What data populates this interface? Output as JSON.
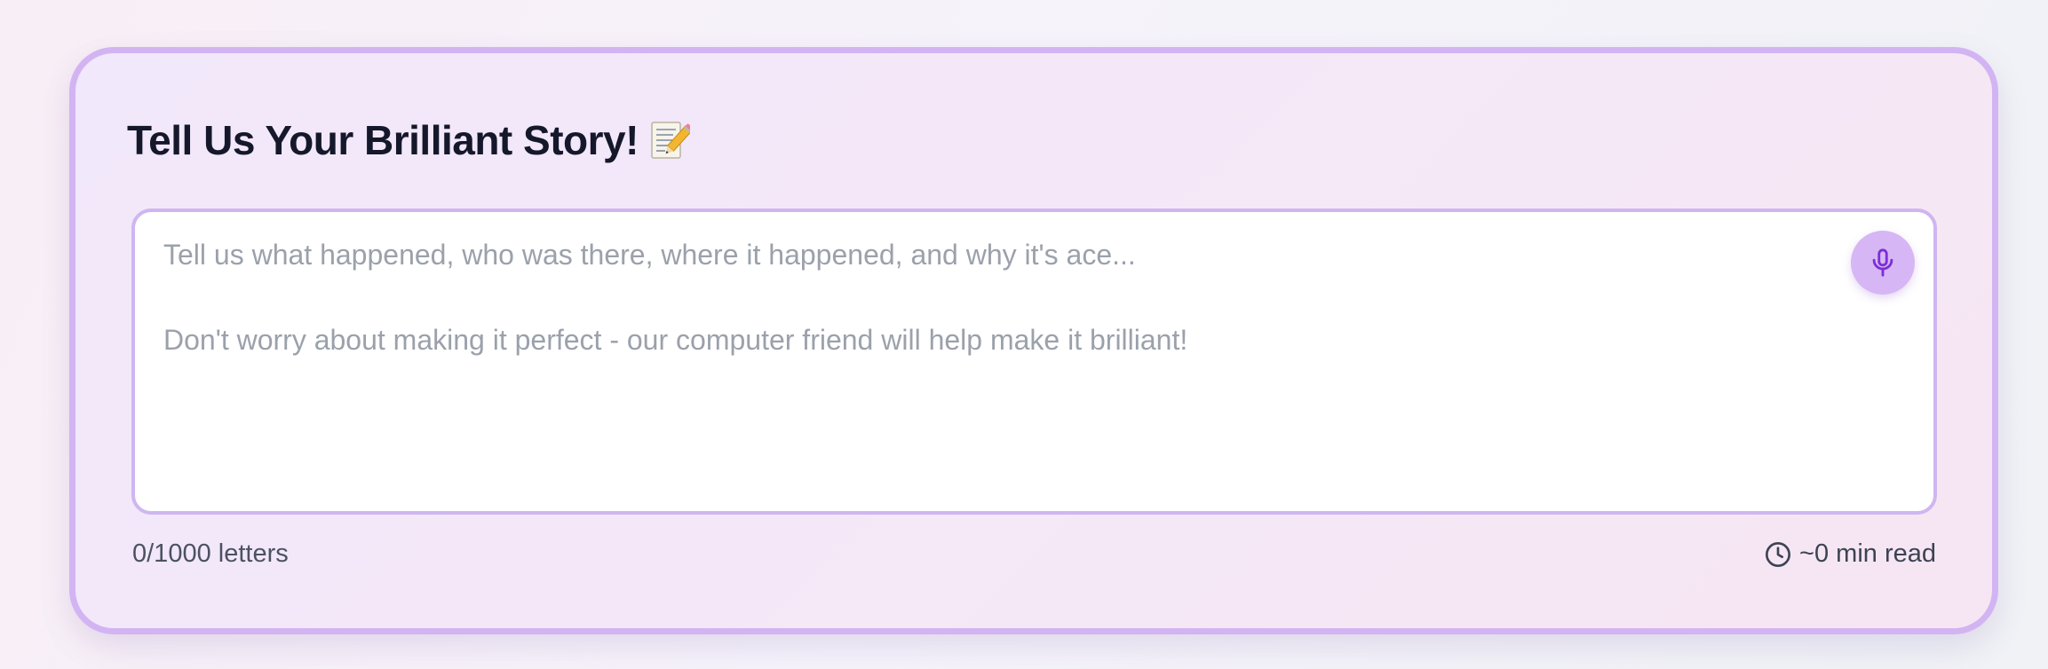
{
  "card": {
    "title": "Tell Us Your Brilliant Story!",
    "title_icon": "memo-icon"
  },
  "story": {
    "value": "",
    "placeholder_line1": "Tell us what happened, who was there, where it happened, and why it's ace...",
    "placeholder_line2": "Don't worry about making it perfect - our computer friend will help make it brilliant!",
    "mic_icon": "microphone-icon"
  },
  "footer": {
    "letter_count": "0/1000 letters",
    "read_time": "~0 min read",
    "read_time_icon": "clock-icon"
  },
  "colors": {
    "card_border": "#d2b4f3",
    "input_border": "#cfb6f1",
    "mic_bg": "#d7b6f5",
    "mic_icon": "#7b2fd6",
    "title": "#15182b",
    "placeholder": "#9ba1ab"
  }
}
